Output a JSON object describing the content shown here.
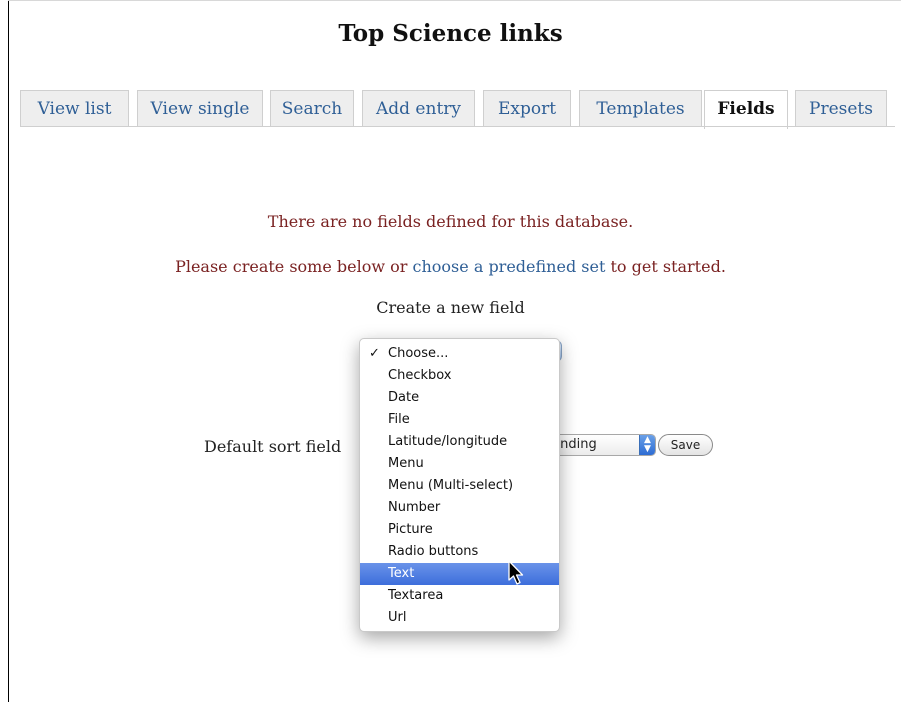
{
  "page": {
    "title": "Top Science links"
  },
  "tabs": [
    {
      "label": "View list"
    },
    {
      "label": "View single"
    },
    {
      "label": "Search"
    },
    {
      "label": "Add entry"
    },
    {
      "label": "Export"
    },
    {
      "label": "Templates"
    },
    {
      "label": "Fields",
      "active": true
    },
    {
      "label": "Presets"
    }
  ],
  "messages": {
    "no_fields": "There are no fields defined for this database.",
    "create_prefix": "Please create some below or ",
    "create_link": "choose a predefined set",
    "create_suffix": " to get started."
  },
  "create_field": {
    "label": "Create a new field"
  },
  "field_type_menu": {
    "selected_index": 0,
    "highlighted_index": 10,
    "options": [
      "Choose...",
      "Checkbox",
      "Date",
      "File",
      "Latitude/longitude",
      "Menu",
      "Menu (Multi-select)",
      "Number",
      "Picture",
      "Radio buttons",
      "Text",
      "Textarea",
      "Url"
    ]
  },
  "sort": {
    "label": "Default sort field",
    "order_visible_text": "cending",
    "save_label": "Save"
  },
  "colors": {
    "link": "#2f5f96",
    "message": "#7a2222",
    "highlight": "#3d6edb"
  },
  "icons": {
    "check": "checkmark-icon",
    "cursor": "mouse-pointer-icon",
    "select_arrows": "up-down-arrows-icon"
  }
}
